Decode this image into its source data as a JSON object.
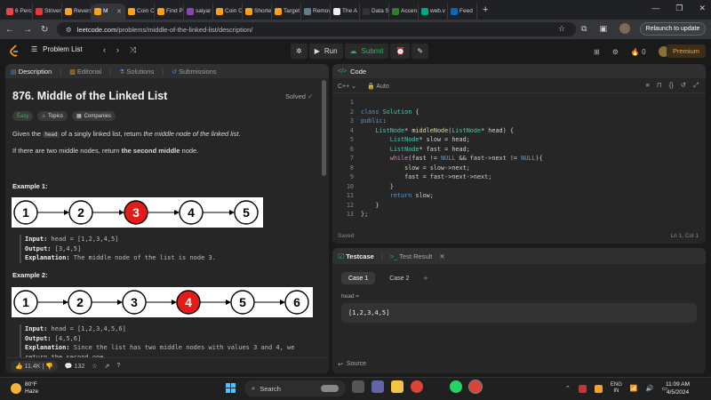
{
  "browser": {
    "tabs": [
      {
        "label": "6 Perc",
        "color": "#e44"
      },
      {
        "label": "Striver",
        "color": "#e53935"
      },
      {
        "label": "Revers",
        "color": "#ffa116"
      },
      {
        "label": "M",
        "color": "#ffa116",
        "active": true
      },
      {
        "label": "Coin C",
        "color": "#ffa116"
      },
      {
        "label": "Find P",
        "color": "#ffa116"
      },
      {
        "label": "saiyar",
        "color": "#8e44ad"
      },
      {
        "label": "Coin C",
        "color": "#ffa116"
      },
      {
        "label": "Shorte",
        "color": "#ffa116"
      },
      {
        "label": "Target",
        "color": "#ffa116"
      },
      {
        "label": "Remov",
        "color": "#607d8b"
      },
      {
        "label": "The A",
        "color": "#eeeeee"
      },
      {
        "label": "Data S",
        "color": "#333"
      },
      {
        "label": "Accen",
        "color": "#2e7d32"
      },
      {
        "label": "web.v",
        "color": "#00a884"
      },
      {
        "label": "Feed",
        "color": "#0a66c2"
      }
    ],
    "url_domain": "leetcode.com",
    "url_path": "/problems/middle-of-the-linked-list/description/",
    "relaunch_label": "Relaunch to update"
  },
  "nav": {
    "problem_list": "Problem List",
    "run": "Run",
    "submit": "Submit",
    "notification_count": "0",
    "premium": "Premium"
  },
  "description": {
    "tabs": [
      "Description",
      "Editorial",
      "Solutions",
      "Submissions"
    ],
    "title": "876. Middle of the Linked List",
    "status": "Solved",
    "badges": [
      "Easy",
      "Topics",
      "Companies"
    ],
    "para1_pre": "Given the",
    "para1_code": "head",
    "para1_mid": "of a singly linked list, return",
    "para1_em": "the middle node of the linked list",
    "para1_end": ".",
    "para2_pre": "If there are two middle nodes, return",
    "para2_bold": "the second middle",
    "para2_end": "node.",
    "example1": {
      "heading": "Example 1:",
      "nodes": [
        "1",
        "2",
        "3",
        "4",
        "5"
      ],
      "highlight": 2,
      "input_label": "Input:",
      "input": "head = [1,2,3,4,5]",
      "output_label": "Output:",
      "output": "[3,4,5]",
      "expl_label": "Explanation:",
      "expl": "The middle node of the list is node 3."
    },
    "example2": {
      "heading": "Example 2:",
      "nodes": [
        "1",
        "2",
        "3",
        "4",
        "5",
        "6"
      ],
      "highlight": 3,
      "input_label": "Input:",
      "input": "head = [1,2,3,4,5,6]",
      "output_label": "Output:",
      "output": "[4,5,6]",
      "expl_label": "Explanation:",
      "expl": "Since the list has two middle nodes with values 3 and 4, we",
      "expl2": "return the second one."
    },
    "likes": "11.4K",
    "comments": "132"
  },
  "code": {
    "header": "Code",
    "language": "C++",
    "mode": "Auto",
    "lines": [
      "",
      "class Solution {",
      "public:",
      "    ListNode* middleNode(ListNode* head) {",
      "        ListNode* slow = head;",
      "        ListNode* fast = head;",
      "        while(fast != NULL && fast->next != NULL){",
      "            slow = slow->next;",
      "            fast = fast->next->next;",
      "        }",
      "        return slow;",
      "    }",
      "};"
    ],
    "saved": "Saved",
    "cursor": "Ln 1, Col 1"
  },
  "testcase": {
    "tabs": [
      "Testcase",
      "Test Result"
    ],
    "cases": [
      "Case 1",
      "Case 2"
    ],
    "input_label": "head =",
    "input_value": "[1,2,3,4,5]",
    "source": "Source"
  },
  "taskbar": {
    "temp": "80°F",
    "weather": "Haze",
    "search": "Search",
    "lang_top": "ENG",
    "lang_bottom": "IN",
    "time": "11:09 AM",
    "date": "4/5/2024"
  }
}
